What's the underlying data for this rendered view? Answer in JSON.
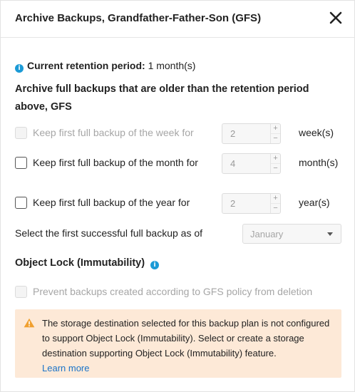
{
  "dialog": {
    "title": "Archive Backups, Grandfather-Father-Son (GFS)",
    "close_icon": "close-icon"
  },
  "retention": {
    "label": "Current retention period:",
    "value": "1 month(s)"
  },
  "section_heading": "Archive full backups that are older than the retention period above, GFS",
  "options": [
    {
      "label": "Keep first full backup of the week for",
      "value": "2",
      "unit": "week(s)",
      "checked": false,
      "disabled": true
    },
    {
      "label": "Keep first full backup of the month for",
      "value": "4",
      "unit": "month(s)",
      "checked": false,
      "disabled": false
    },
    {
      "label": "Keep first full backup of the year for",
      "value": "2",
      "unit": "year(s)",
      "checked": false,
      "disabled": false
    }
  ],
  "stepper_symbols": {
    "plus": "+",
    "minus": "−"
  },
  "first_backup": {
    "label": "Select the first successful full backup as of",
    "selected": "January"
  },
  "object_lock": {
    "heading": "Object Lock (Immutability)",
    "checkbox_label": "Prevent backups created according to GFS policy from deletion",
    "checkbox_disabled": true
  },
  "warning": {
    "text": "The storage destination selected for this backup plan is not configured to support Object Lock (Immutability). Select or create a storage destination supporting Object Lock (Immutability) feature.",
    "link": "Learn more"
  },
  "colors": {
    "info_blue": "#1b9ad6",
    "warning_bg": "#fde9d7",
    "warning_icon": "#f0a030",
    "link": "#1a73c8"
  }
}
